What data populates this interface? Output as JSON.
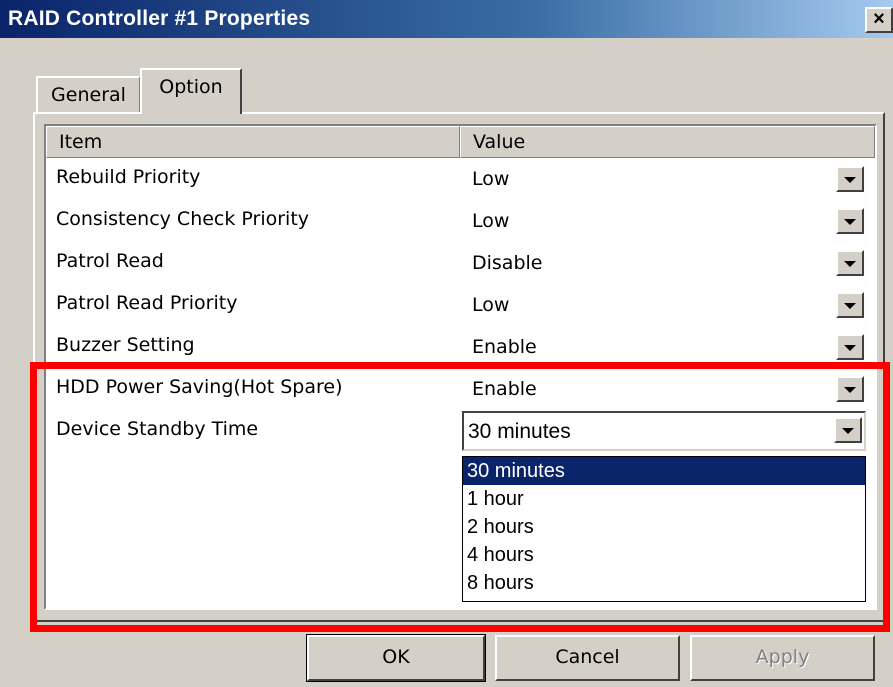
{
  "window": {
    "title": "RAID Controller #1 Properties",
    "close_label": "×"
  },
  "tabs": [
    {
      "label": "General",
      "active": false
    },
    {
      "label": "Option",
      "active": true
    }
  ],
  "list": {
    "columns": [
      "Item",
      "Value"
    ],
    "rows": [
      {
        "item": "Rebuild Priority",
        "value": "Low"
      },
      {
        "item": "Consistency Check Priority",
        "value": "Low"
      },
      {
        "item": "Patrol Read",
        "value": "Disable"
      },
      {
        "item": "Patrol Read Priority",
        "value": "Low"
      },
      {
        "item": "Buzzer Setting",
        "value": "Enable"
      },
      {
        "item": "HDD Power Saving(Hot Spare)",
        "value": "Enable"
      },
      {
        "item": "Device Standby Time",
        "value": "30 minutes"
      }
    ]
  },
  "dropdown": {
    "selected": "30 minutes",
    "options": [
      "30 minutes",
      "1 hour",
      "2 hours",
      "4 hours",
      "8 hours"
    ]
  },
  "buttons": {
    "ok": "OK",
    "cancel": "Cancel",
    "apply": "Apply"
  },
  "colors": {
    "highlight": "#ff0000",
    "selection": "#0a246a",
    "face": "#d4d0c8"
  },
  "icons": {
    "dropdown": "chevron-down-icon",
    "close": "close-icon"
  }
}
